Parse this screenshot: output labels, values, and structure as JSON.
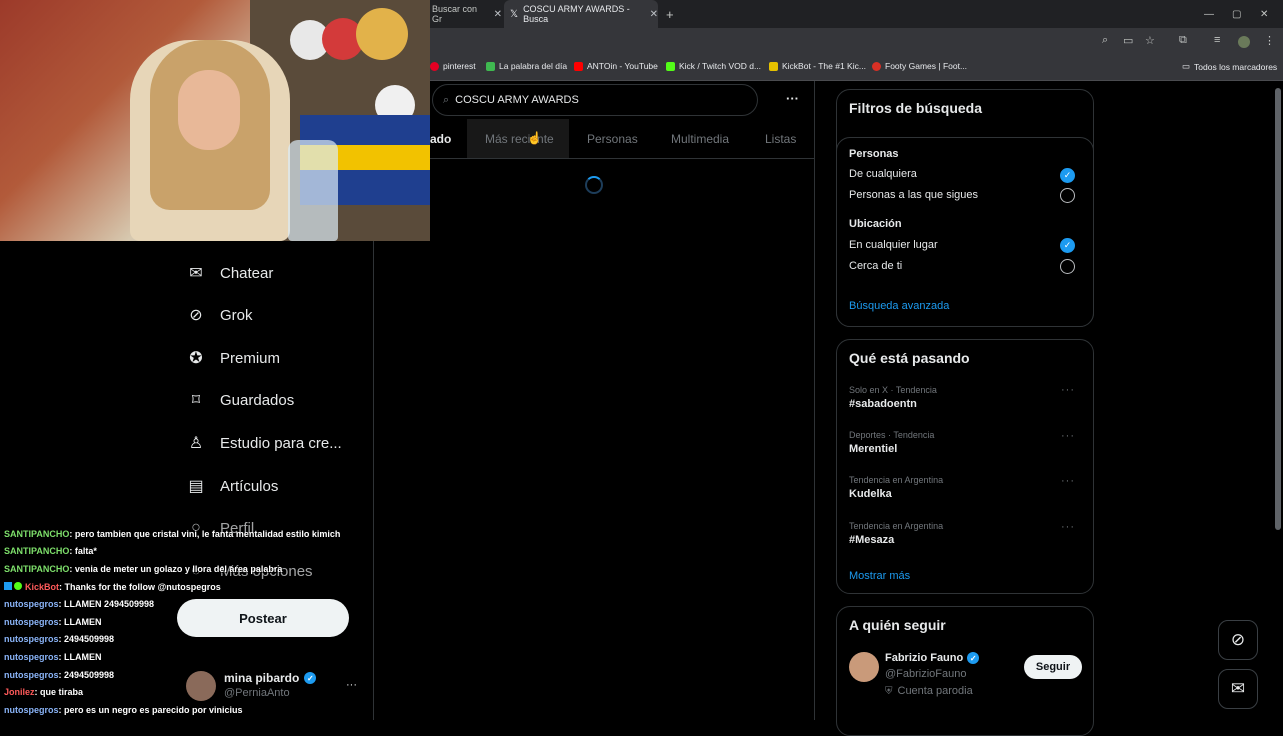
{
  "browser": {
    "tabs": [
      {
        "title": "Buscar con Gr",
        "close": "✕"
      },
      {
        "title": "COSCU ARMY AWARDS - Busca",
        "close": "✕"
      }
    ],
    "new_tab": "+",
    "window_controls": [
      "—",
      "▢",
      "✕"
    ],
    "bookmarks": [
      {
        "label": "pinterest",
        "color": "#e60023"
      },
      {
        "label": "La palabra del día",
        "color": "#3fb950"
      },
      {
        "label": "ANTOin - YouTube",
        "color": "#ff0000"
      },
      {
        "label": "Kick / Twitch VOD d...",
        "color": "#53fc18"
      },
      {
        "label": "KickBot - The #1 Kic...",
        "color": "#e5c100"
      },
      {
        "label": "Footy Games | Foot...",
        "color": "#d93025"
      }
    ],
    "bookmarks_folder": "Todos los marcadores"
  },
  "left_nav": {
    "items": [
      {
        "label": "Chatear",
        "icon": "mail-icon"
      },
      {
        "label": "Grok",
        "icon": "grok-icon"
      },
      {
        "label": "Premium",
        "icon": "verified-icon"
      },
      {
        "label": "Guardados",
        "icon": "bookmark-icon"
      },
      {
        "label": "Estudio para cre...",
        "icon": "flask-icon"
      },
      {
        "label": "Artículos",
        "icon": "article-icon"
      },
      {
        "label": "Perfil",
        "icon": "profile-icon"
      },
      {
        "label": "Más opciones",
        "icon": "more-icon"
      }
    ],
    "post_button": "Postear",
    "account": {
      "name": "mina pibardo",
      "handle": "@PerniaAnto",
      "more": "···"
    }
  },
  "chat": [
    {
      "user": "SANTIPANCHO",
      "msg": ": pero tambien que cristal vini, le fanta mentalidad estilo kimich",
      "color": "u1"
    },
    {
      "user": "SANTIPANCHO",
      "msg": ": falta*",
      "color": "u1"
    },
    {
      "user": "SANTIPANCHO",
      "msg": ": venia de meter un golazo y llora del área palabra",
      "color": "u1"
    },
    {
      "user": "KickBot",
      "msg": ": Thanks for the follow @nutospegros",
      "color": "u3"
    },
    {
      "user": "nutospegros",
      "msg": ": LLAMEN 2494509998",
      "color": "u2"
    },
    {
      "user": "nutospegros",
      "msg": ": LLAMEN",
      "color": "u2"
    },
    {
      "user": "nutospegros",
      "msg": ": 2494509998",
      "color": "u2"
    },
    {
      "user": "nutospegros",
      "msg": ": LLAMEN",
      "color": "u2"
    },
    {
      "user": "nutospegros",
      "msg": ": 2494509998",
      "color": "u2"
    },
    {
      "user": "Jonilez",
      "msg": ": que tiraba",
      "color": "u3"
    },
    {
      "user": "nutospegros",
      "msg": ": pero es un negro es parecido por vinicius",
      "color": "u2"
    }
  ],
  "search": {
    "query": "COSCU ARMY AWARDS",
    "more": "···",
    "tabs": [
      "ado",
      "Más reciente",
      "Personas",
      "Multimedia",
      "Listas"
    ]
  },
  "filters": {
    "title": "Filtros de búsqueda",
    "people_heading": "Personas",
    "people_options": [
      "De cualquiera",
      "Personas a las que sigues"
    ],
    "location_heading": "Ubicación",
    "location_options": [
      "En cualquier lugar",
      "Cerca de ti"
    ],
    "advanced_link": "Búsqueda avanzada"
  },
  "trends": {
    "title": "Qué está pasando",
    "items": [
      {
        "meta": "Solo en X · Tendencia",
        "name": "#sabadoentn"
      },
      {
        "meta": "Deportes · Tendencia",
        "name": "Merentiel"
      },
      {
        "meta": "Tendencia en Argentina",
        "name": "Kudelka"
      },
      {
        "meta": "Tendencia en Argentina",
        "name": "#Mesaza"
      }
    ],
    "show_more": "Mostrar más"
  },
  "who_to_follow": {
    "title": "A quién seguir",
    "user": {
      "name": "Fabrizio Fauno",
      "handle": "@FabrizioFauno",
      "label": "Cuenta parodia",
      "follow": "Seguir"
    }
  }
}
